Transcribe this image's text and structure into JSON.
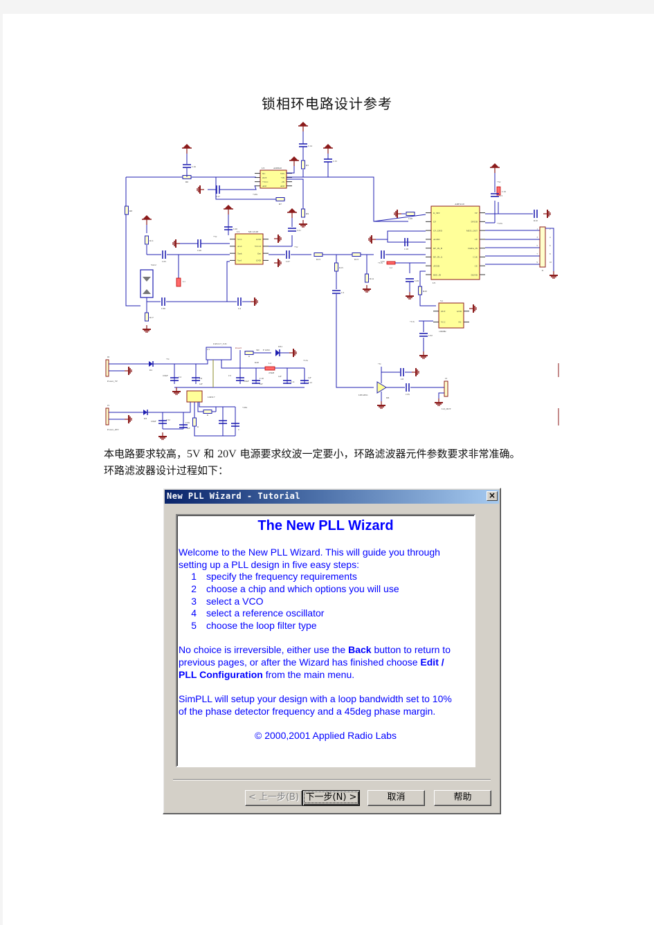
{
  "document": {
    "title": "锁相环电路设计参考",
    "paragraph1_a": "本电路要求较高，",
    "paragraph1_5v": "5V",
    "paragraph1_b": " 和 ",
    "paragraph1_20v": "20V",
    "paragraph1_c": " 电源要求纹波一定要小，环路滤波器元件参数要求非常准确。",
    "paragraph2": "环路滤波器设计过程如下："
  },
  "schematic": {
    "colors": {
      "wire": "#1f1fb0",
      "ground": "#8b1a1a",
      "chip_fill": "#ffff99",
      "chip_border": "#8b1a1a",
      "resistor_fill": "#ffffcc",
      "lead": "#333333"
    },
    "labels": {
      "u_ad8610_ref": "U3",
      "u_ad8610_name": "AD8610",
      "ad8610_pins_left": [
        "NC",
        "OUT",
        "+VCC",
        "ADJ"
      ],
      "ad8610_pins_right": [
        "VSS",
        "+IN",
        "-IN",
        "ADJ"
      ],
      "u_mc12148_ref": "U1",
      "u_mc12148_name": "MC12148",
      "mc12148_pins_left": [
        "VCC",
        "AGC",
        "Tank",
        "Vref"
      ],
      "mc12148_pins_right": [
        "GND",
        "VCCO",
        "Out",
        "GND"
      ],
      "u_adf_name": "ADF4110",
      "u_adf_ref": "U5",
      "adf_pins_left": [
        "R_SET",
        "CP",
        "CP_GND",
        "AGND",
        "RF_IN_B",
        "RF_IN_A",
        "AVDD",
        "REF_IN"
      ],
      "adf_pins_right": [
        "VP",
        "DVDD",
        "MUX_OUT",
        "LE",
        "DATA_IN",
        "CLK",
        "CE",
        "DGND"
      ],
      "osc_ref": "Y1",
      "osc_pins": [
        "OUT",
        "GND",
        "VCC",
        "NC"
      ],
      "osc_freq": "10MHz",
      "amp_name": "UPC2651",
      "amp_ref": "D6",
      "lo_out": "LO_OUT",
      "lo_ref": "J3",
      "connector_ref": "J1",
      "connector_pins_left": [
        "1",
        "3",
        "5",
        "7",
        "9"
      ],
      "connector_pins_right": [
        "2",
        "4",
        "6",
        "8",
        "10"
      ],
      "reg1_name": "LM1117_3.3v",
      "reg1_ref": "U1",
      "reg2_name": "LM317",
      "power5_label": "Power_5V",
      "power5_ref": "J6",
      "power20_label": "Power_20V",
      "power20_ref": "J5",
      "varactor": "VaC2",
      "vcc_5": "+5v",
      "vcc_33": "+3.3v",
      "vcc_20": "+20v",
      "led_label": "F LED",
      "led_ref": "DS1",
      "inductor_l4": "L4",
      "l4_value": "470uH",
      "parts": [
        "C16",
        "R6",
        "C17",
        "C14",
        "C15",
        "R5",
        "R7",
        "R9",
        "R8",
        "C20",
        "C21",
        "R11",
        "C26",
        "C25",
        "L1",
        "R17",
        "C30",
        "C4",
        "C27",
        "R13",
        "R15",
        "C3",
        "C28",
        "R10",
        "C19",
        "L3",
        "C18",
        "C31",
        "R14",
        "L2",
        "R16",
        "C29",
        "R20",
        "C32",
        "C8",
        "C35",
        "D1",
        "D3",
        "C2",
        "C9",
        "C5",
        "C10",
        "C11",
        "C12",
        "C52",
        "C59",
        "R",
        "K20"
      ],
      "values": [
        "100uF",
        "1uF",
        "100uF",
        "1uF",
        "1uF",
        "1uF",
        "100uF",
        "1uF",
        "300"
      ]
    }
  },
  "dialog": {
    "title": "New PLL Wizard - Tutorial",
    "close_icon": "×",
    "heading": "The New PLL Wizard",
    "intro_line1": "Welcome to the New PLL Wizard.   This will guide you through",
    "intro_line2": "setting up a PLL design in five easy steps:",
    "steps": [
      {
        "num": "1",
        "text": "specify the frequency requirements"
      },
      {
        "num": "2",
        "text": "choose a chip and which options you will use"
      },
      {
        "num": "3",
        "text": "select a VCO"
      },
      {
        "num": "4",
        "text": "select a reference oscillator"
      },
      {
        "num": "5",
        "text": "choose the loop filter type"
      }
    ],
    "note_line1_a": "No choice is irreversible,  either use the ",
    "note_line1_bold": "Back",
    "note_line1_b": " button to return to",
    "note_line2_a": "previous pages,  or after the Wizard has finished choose ",
    "note_line2_bold": "Edit /",
    "note_line3_bold": "PLL Configuration",
    "note_line3_b": " from the main menu.",
    "sim_line1": "SimPLL will setup your design with a loop bandwidth set to 10%",
    "sim_line2": "of the phase detector frequency and a 45deg phase margin.",
    "copyright": "© 2000,2001 Applied Radio Labs",
    "buttons": {
      "back": "< 上一步(B)",
      "next": "下一步(N) >",
      "cancel": "取消",
      "help": "帮助"
    },
    "text_color": "#0000ff",
    "title_gradient": [
      "#0a246a",
      "#a6caf0"
    ]
  }
}
